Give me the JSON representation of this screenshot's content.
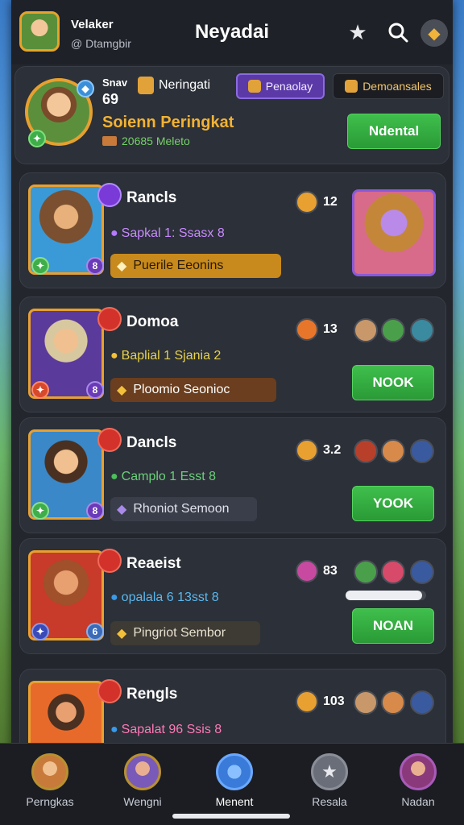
{
  "header": {
    "player_name": "Velaker",
    "player_handle": "@ Dtamgbir",
    "title": "Neyadai",
    "icons": [
      "star-icon",
      "search-icon",
      "coin-icon"
    ]
  },
  "profile": {
    "stat_label": "Snav",
    "stat_value": "69",
    "chip_label": "Neringati",
    "purple_button": "Penaolay",
    "dark_button": "Demoansales",
    "rank_title": "Soienn Peringkat",
    "rank_sub": "20685 Meleto",
    "action_button": "Ndental"
  },
  "cards": [
    {
      "name": "Rancls",
      "subtitle": "Sapkal 1: Ssasx 8",
      "subtitle_color": "#c88aff",
      "pill": "Puerile Eeonins",
      "pill_style": "gold",
      "level": "12",
      "action": "",
      "right": "image"
    },
    {
      "name": "Domoa",
      "subtitle": "Baplial 1 Sjania 2",
      "subtitle_color": "#e8d24a",
      "pill": "Ploomio Seonioc",
      "pill_style": "brown",
      "level": "13",
      "action": "NOOK",
      "right": "button"
    },
    {
      "name": "Dancls",
      "subtitle": "Camplo 1 Esst 8",
      "subtitle_color": "#6ad07a",
      "pill": "Rhoniot Semoon",
      "pill_style": "dark",
      "level": "3.2",
      "action": "YOOK",
      "right": "button"
    },
    {
      "name": "Reaeist",
      "subtitle": "opalala 6 13sst 8",
      "subtitle_color": "#5ab8f0",
      "pill": "Pingriot Sembor",
      "pill_style": "dark",
      "level": "83",
      "action": "NOAN",
      "right": "progress",
      "progress": 0.95
    },
    {
      "name": "Rengls",
      "subtitle": "Sapalat 96 Ssis 8",
      "subtitle_color": "#ff7ab8",
      "pill": "",
      "pill_style": "none",
      "level": "103",
      "action": "",
      "right": "none"
    }
  ],
  "nav": [
    {
      "label": "Perngkas",
      "icon": "profile-icon"
    },
    {
      "label": "Wengni",
      "icon": "character-icon"
    },
    {
      "label": "Menent",
      "icon": "shield-icon"
    },
    {
      "label": "Resala",
      "icon": "star-badge-icon"
    },
    {
      "label": "Nadan",
      "icon": "hero-icon"
    }
  ],
  "colors": {
    "accent_green": "#3fbf4c",
    "accent_gold": "#f2b233",
    "accent_purple": "#5b3aa8",
    "panel": "#2c3038"
  }
}
